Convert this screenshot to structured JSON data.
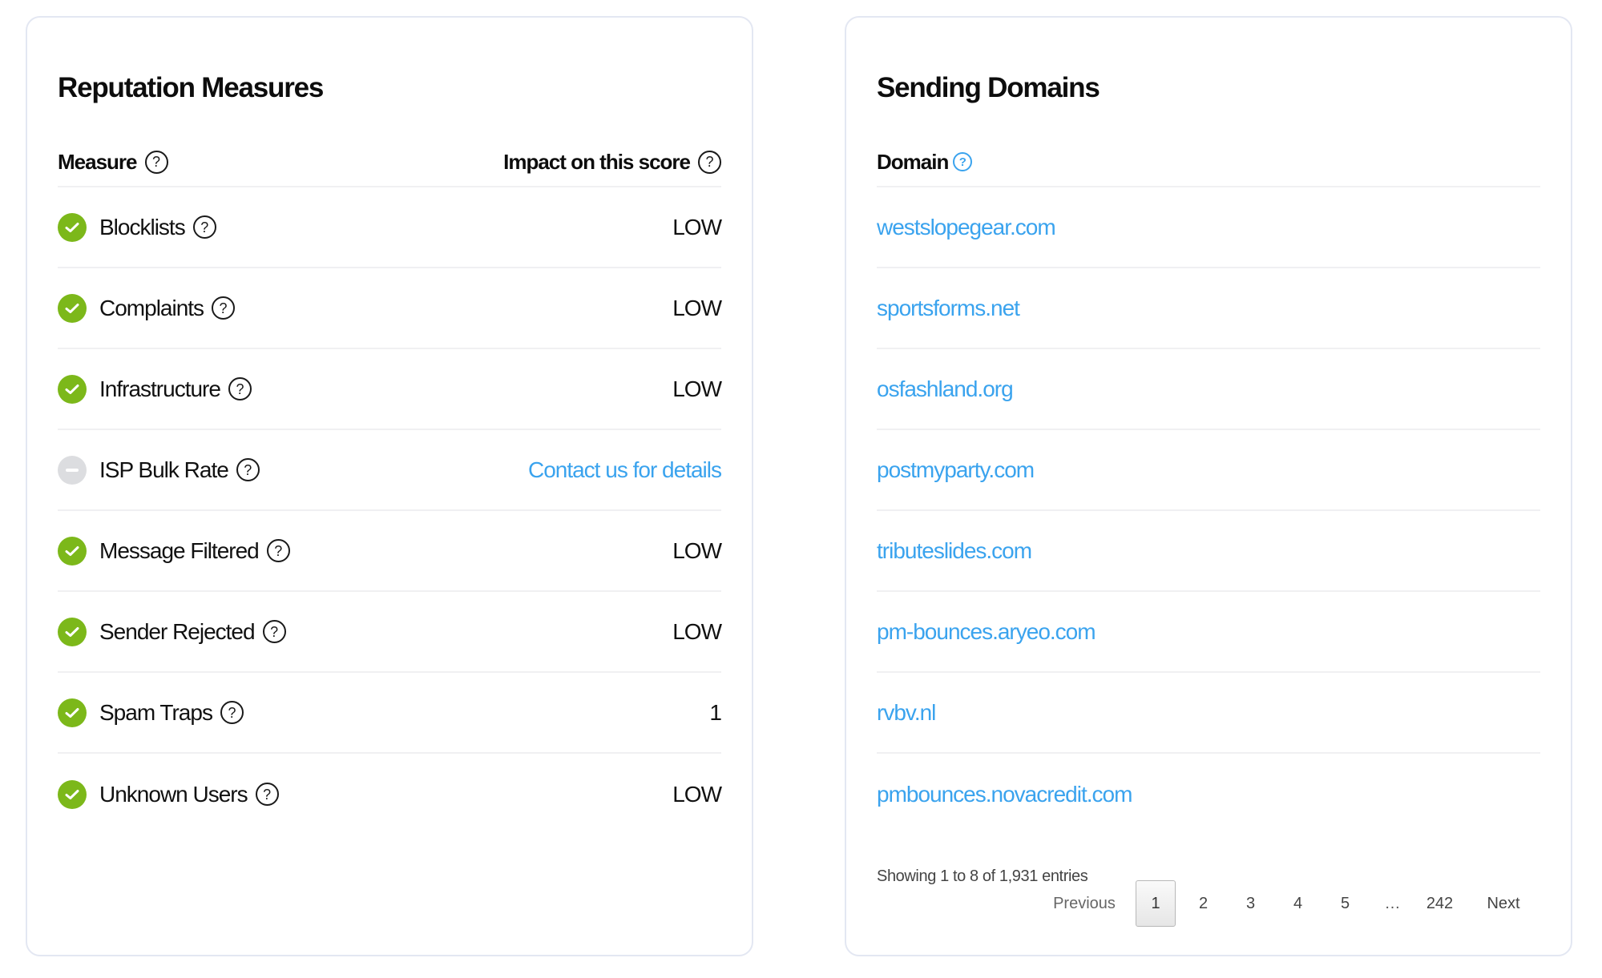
{
  "colors": {
    "accent": "#3aa3ee",
    "status_ok": "#7cb81a",
    "status_na": "#dcdde0",
    "card_border": "#e3e7f2"
  },
  "reputation": {
    "title": "Reputation Measures",
    "header": {
      "measure_label": "Measure",
      "impact_label": "Impact on this score",
      "help_icon": "question-circle-icon"
    },
    "rows": [
      {
        "measure": "Blocklists",
        "status": "ok",
        "status_icon": "check-circle-icon",
        "impact": "LOW",
        "impact_is_link": false
      },
      {
        "measure": "Complaints",
        "status": "ok",
        "status_icon": "check-circle-icon",
        "impact": "LOW",
        "impact_is_link": false
      },
      {
        "measure": "Infrastructure",
        "status": "ok",
        "status_icon": "check-circle-icon",
        "impact": "LOW",
        "impact_is_link": false
      },
      {
        "measure": "ISP Bulk Rate",
        "status": "na",
        "status_icon": "minus-circle-icon",
        "impact": "Contact us for details",
        "impact_is_link": true
      },
      {
        "measure": "Message Filtered",
        "status": "ok",
        "status_icon": "check-circle-icon",
        "impact": "LOW",
        "impact_is_link": false
      },
      {
        "measure": "Sender Rejected",
        "status": "ok",
        "status_icon": "check-circle-icon",
        "impact": "LOW",
        "impact_is_link": false
      },
      {
        "measure": "Spam Traps",
        "status": "ok",
        "status_icon": "check-circle-icon",
        "impact": "1",
        "impact_is_link": false
      },
      {
        "measure": "Unknown Users",
        "status": "ok",
        "status_icon": "check-circle-icon",
        "impact": "LOW",
        "impact_is_link": false
      }
    ]
  },
  "domains": {
    "title": "Sending Domains",
    "header": {
      "domain_label": "Domain",
      "help_icon": "question-circle-icon"
    },
    "rows": [
      "westslopegear.com",
      "sportsforms.net",
      "osfashland.org",
      "postmyparty.com",
      "tributeslides.com",
      "pm-bounces.aryeo.com",
      "rvbv.nl",
      "pmbounces.novacredit.com"
    ],
    "entries_info": "Showing 1 to 8 of 1,931 entries",
    "pagination": {
      "previous_label": "Previous",
      "next_label": "Next",
      "current_page": "1",
      "pages": [
        "1",
        "2",
        "3",
        "4",
        "5",
        "…",
        "242"
      ]
    }
  }
}
